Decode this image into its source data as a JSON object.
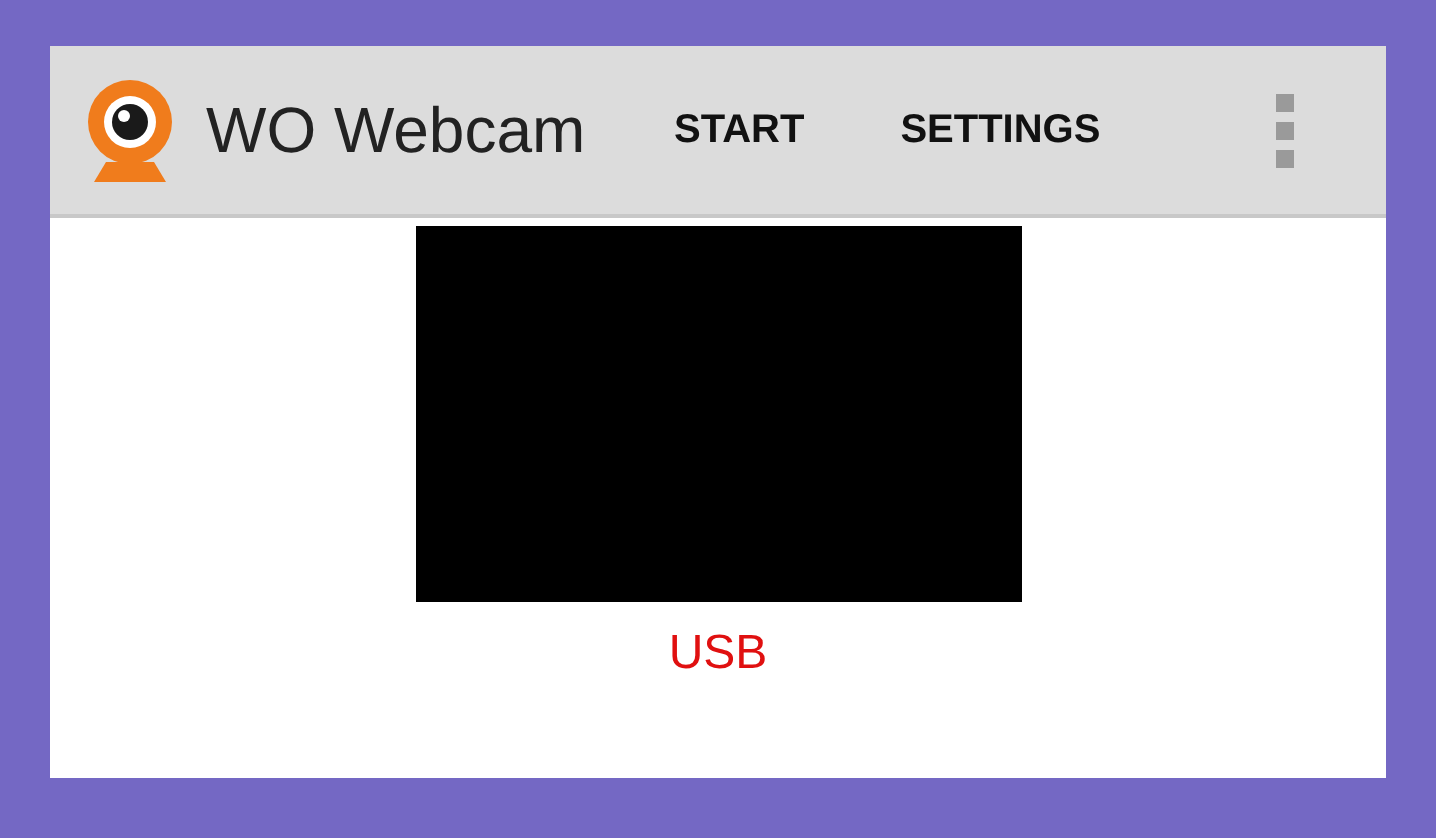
{
  "app_bar": {
    "title": "WO Webcam",
    "actions": [
      {
        "label": "START"
      },
      {
        "label": "SETTINGS"
      }
    ]
  },
  "source": {
    "label": "USB"
  }
}
